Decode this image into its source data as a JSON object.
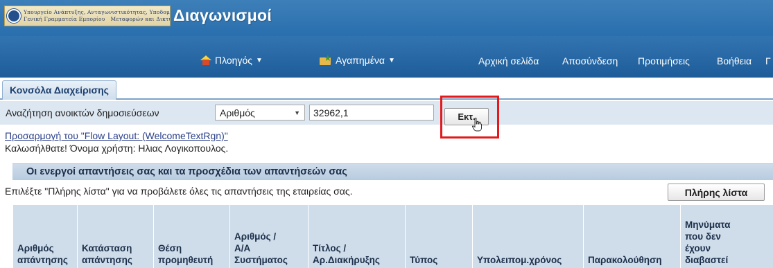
{
  "header": {
    "logo_line1": [
      "Υπουργείο Ανάπτυξης, Ανταγωνιστικότητας, Υποδομών,"
    ],
    "logo_line2": [
      "Γενική Γραμματεία Εμπορίου",
      "Μεταφορών και Δικτύων"
    ],
    "app_title": "Διαγωνισμοί",
    "nav_navigator": "Πλοηγός",
    "nav_favorites": "Αγαπημένα",
    "links": {
      "home": "Αρχική σελίδα",
      "logout": "Αποσύνδεση",
      "preferences": "Προτιμήσεις",
      "help": "Βοήθεια",
      "overflow": "Γ"
    }
  },
  "tabs": {
    "active_label": "Κονσόλα Διαχείρισης"
  },
  "search": {
    "label": "Αναζήτηση ανοικτών δημοσιεύσεων",
    "select_value": "Αριθμός",
    "input_value": "32962,1",
    "go_label": "Εκτ."
  },
  "welcome": {
    "personalize_link": "Προσαρμογή του \"Flow Layout: (WelcomeTextRgn)\"",
    "greeting": "Καλωσήλθατε! Όνομα χρήστη: Ηλιας Λογικοπουλος."
  },
  "section": {
    "title": "Οι ενεργοί απαντήσεις σας και τα προσχέδια των απαντήσεών σας",
    "description": "Επιλέξτε \"Πλήρης λίστα\" για να προβάλετε όλες τις απαντήσεις της εταιρείας σας.",
    "full_list_label": "Πλήρης λίστα"
  },
  "table": {
    "columns": [
      [
        "Αριθμός",
        "απάντησης"
      ],
      [
        "Κατάσταση",
        "απάντησης"
      ],
      [
        "Θέση",
        "προμηθευτή"
      ],
      [
        "Αριθμός /",
        "Α/Α",
        "Συστήματος"
      ],
      [
        "Τίτλος /",
        "Αρ.Διακήρυξης"
      ],
      [
        "Τύπος"
      ],
      [
        "Υπολειπομ.χρόνος"
      ],
      [
        "Παρακολούθηση"
      ],
      [
        "Μηνύματα",
        "που δεν",
        "έχουν",
        "διαβαστεί"
      ]
    ]
  },
  "colors": {
    "header_blue": "#2a6fae",
    "section_blue": "#cfdcea",
    "highlight_red": "#e3191c",
    "link_blue": "#2a3f8a"
  }
}
